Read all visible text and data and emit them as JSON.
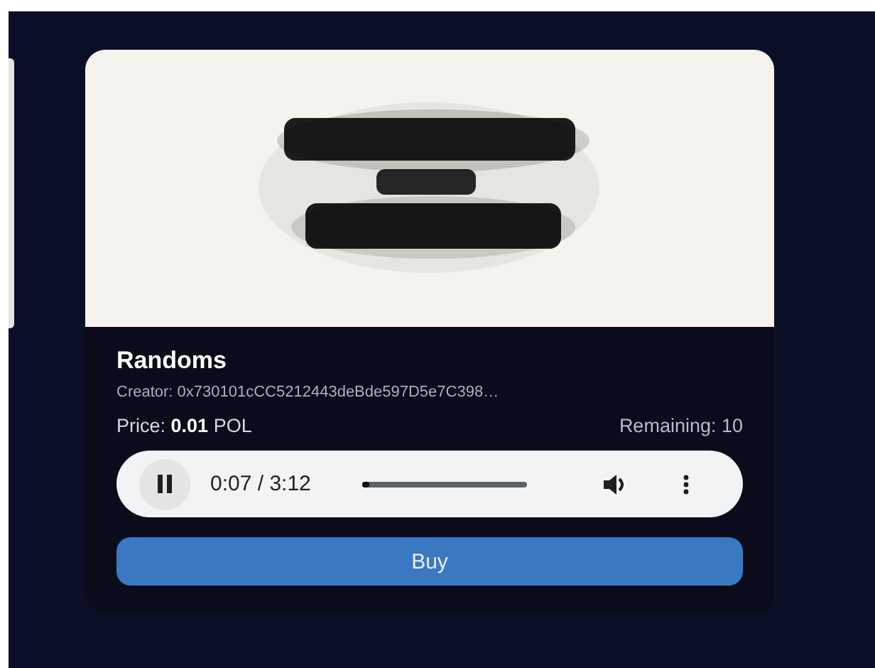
{
  "card": {
    "title": "Randoms",
    "creator": "Creator: 0x730101cCC5212443deBde597D5e7C398…",
    "price": {
      "label": "Price:",
      "amount": "0.01",
      "currency": "POL"
    },
    "remaining": "Remaining: 10",
    "player": {
      "playing": true,
      "time": "0:07 / 3:12",
      "level": 0.04
    },
    "buy_button": "Buy"
  }
}
